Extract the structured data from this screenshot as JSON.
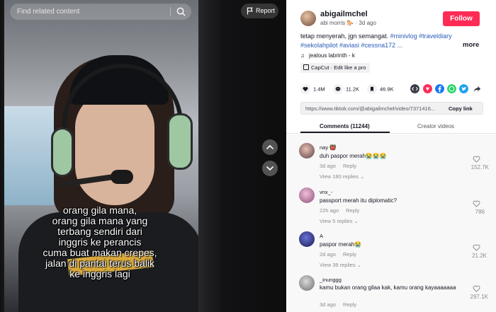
{
  "search": {
    "placeholder": "Find related content"
  },
  "report": {
    "label": "Report"
  },
  "video": {
    "caption_lines": [
      "orang gila mana,",
      "orang gila mana yang",
      "terbang sendiri dari",
      "inggris ke perancis",
      "cuma buat makan crepes,",
      "jalan di pantai terus balik",
      "ke inggris lagi"
    ]
  },
  "author": {
    "username": "abigailmchel",
    "display_name": "abi morris",
    "name_emoji": "🐎",
    "separator": "·",
    "time": "3d ago",
    "follow_label": "Follow"
  },
  "description": {
    "text": "tetap menyerah, jgn semangat. ",
    "tags_line1": "#minivlog #traveldiary",
    "tags_line2": "#sekolahpilot #aviasi #cessna172 ...",
    "more_label": "more"
  },
  "music": {
    "note_icon": "♫",
    "title": "jealous labrinth - k"
  },
  "capcut": {
    "label": "CapCut · Edit like a pro"
  },
  "stats": {
    "likes": "1.4M",
    "comments": "11.2K",
    "saves": "46.9K"
  },
  "share": {
    "icons": [
      "embed-icon",
      "pinterest-icon",
      "facebook-icon",
      "whatsapp-icon",
      "twitter-icon",
      "share-arrow-icon"
    ],
    "colors": {
      "embed": "#3b3c45",
      "pinterest": "#fe2c55",
      "facebook": "#1877f2",
      "whatsapp": "#25d366",
      "twitter": "#1da1f2",
      "share": "#3b3c45"
    }
  },
  "link": {
    "url": "https://www.tiktok.com/@abigailmchel/video/7371416...",
    "copy_label": "Copy link"
  },
  "tabs": [
    {
      "label": "Comments (11244)",
      "active": true
    },
    {
      "label": "Creator videos",
      "active": false
    }
  ],
  "comments": [
    {
      "user": "nay 👹",
      "text": "duh paspor merah😭😭😭",
      "time": "3d ago",
      "reply_label": "Reply",
      "replies": "View 180 replies ⌄",
      "likes": "152.7K"
    },
    {
      "user": "vnx_-",
      "text": "passport merah itu diplomatic?",
      "time": "22h ago",
      "reply_label": "Reply",
      "replies": "View 5 replies ⌄",
      "likes": "786"
    },
    {
      "user": "A",
      "text": "paspor merah😭",
      "time": "2d ago",
      "reply_label": "Reply",
      "replies": "View 39 replies ⌄",
      "likes": "21.2K"
    },
    {
      "user": "_inunggg",
      "text": "kamu bukan orang gilaa kak, kamu orang kayaaaaaaa",
      "time": "3d ago",
      "reply_label": "Reply",
      "likes": "297.1K"
    }
  ],
  "colors": {
    "accent": "#fe2c55",
    "hashtag": "#2b5db9",
    "text": "#161823",
    "muted": "#8a8b91"
  }
}
